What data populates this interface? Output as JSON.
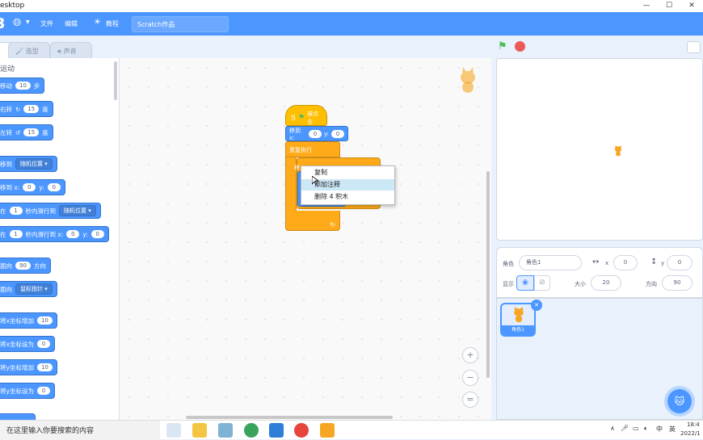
{
  "titlebar": {
    "title": "esktop",
    "minimize": "—",
    "maximize": "☐",
    "close": "✕"
  },
  "menubar": {
    "logo": "3",
    "file": "文件",
    "edit": "编辑",
    "tutorials": "教程",
    "project_title": "Scratch作品"
  },
  "tabs": {
    "code": "",
    "costumes": "造型",
    "sounds": "声音"
  },
  "palette": {
    "category": "运动",
    "blocks": [
      {
        "label": "移动",
        "oval": "10",
        "suffix": "步"
      },
      {
        "label": "右转",
        "oval": "15",
        "suffix": "度"
      },
      {
        "label": "左转",
        "oval": "15",
        "suffix": "度"
      },
      {
        "label": "移到",
        "dropdown": "随机位置"
      },
      {
        "label": "移到 x:",
        "oval": "0",
        "label2": "y:",
        "oval2": "0"
      },
      {
        "label": "在",
        "oval": "1",
        "label2": "秒内滑行到",
        "dropdown": "随机位置"
      },
      {
        "label": "在",
        "oval": "1",
        "label2": "秒内滑行到 x:",
        "oval2": "0",
        "label3": "y:",
        "oval3": "0"
      },
      {
        "label": "面向",
        "oval": "90",
        "suffix": "方向"
      },
      {
        "label": "面向",
        "dropdown": "鼠标指针"
      },
      {
        "label": "将x坐标增加",
        "oval": "10"
      },
      {
        "label": "将x坐标设为",
        "oval": "0"
      },
      {
        "label": "将y坐标增加",
        "oval": "10"
      },
      {
        "label": "将y坐标设为",
        "oval": "0"
      }
    ]
  },
  "script": {
    "hat": {
      "pre": "当",
      "post": "被点击"
    },
    "goto": {
      "label": "移到 x:",
      "x": "0",
      "ylabel": "y:",
      "y": "0"
    },
    "forever": "重复执行",
    "inner": "移"
  },
  "context_menu": {
    "items": [
      "复制",
      "添加注释",
      "删除 4 积木"
    ],
    "highlighted_index": 1
  },
  "zoom": {
    "in": "+",
    "out": "−",
    "reset": "="
  },
  "sprite_info": {
    "sprite_label": "角色",
    "sprite_name": "角色1",
    "x_label": "x",
    "x_value": "0",
    "y_label": "y",
    "y_value": "0",
    "show_label": "显示",
    "size_label": "大小",
    "size_value": "20",
    "direction_label": "方向",
    "direction_value": "90"
  },
  "sprites": [
    {
      "name": "角色1"
    }
  ],
  "taskbar": {
    "search_placeholder": "在这里输入你要搜索的内容",
    "tray_ime": "中",
    "tray_ime2": "英",
    "time": "18:4",
    "date": "2022/1"
  },
  "colors": {
    "accent": "#4c97ff",
    "events": "#ffbf00",
    "control": "#ffab19",
    "motion": "#4c97ff",
    "green_flag": "#4cbf56",
    "stop": "#ec5959"
  }
}
